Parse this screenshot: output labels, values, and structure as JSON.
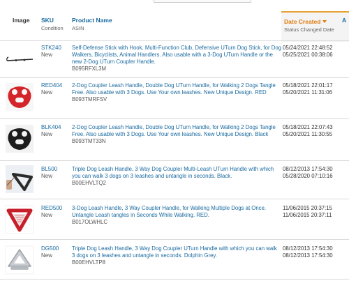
{
  "header": {
    "image": "Image",
    "sku": "SKU",
    "condition": "Condition",
    "product_name": "Product Name",
    "asin": "ASIN",
    "date_created": "Date Created",
    "status_changed": "Status Changed Date",
    "extra": "A"
  },
  "colors": {
    "link": "#1a6aa0",
    "sort_accent": "#e07b10"
  },
  "rows": [
    {
      "sku": "STK240",
      "condition": "New",
      "desc": "Self-Defense Stick with Hook, Multi-Function Club, Defensive UTurn Dog Stick, for Dog Walkers, Bicyclists, Animal Handlers. Also usable with a 3-Dog UTurn Handle or the new 2-Dog UTurn Coupler Handle.",
      "asin": "B095RFXL3M",
      "created": "05/24/2021 22:48:52",
      "changed": "05/25/2021 00:38:06",
      "thumb_icon": "stick-product-icon"
    },
    {
      "sku": "RED404",
      "condition": "New",
      "desc": "2-Dog Coupler Leash Handle, Double Dog UTurn Handle, for Walking 2 Dogs Tangle Free. Also usable with 3 Dogs. Use Your own leashes. New Unique Design. RED",
      "asin": "B093TMRFSV",
      "created": "05/18/2021 22:01:17",
      "changed": "05/20/2021 11:31:06",
      "thumb_icon": "red-coupler-handle-icon"
    },
    {
      "sku": "BLK404",
      "condition": "New",
      "desc": "2-Dog Coupler Leash Handle, Double Dog UTurn Handle, for Walking 2 Dogs Tangle Free. Also usable with 3 Dogs. Use Your own leashes. New Unique Design. Black",
      "asin": "B093TMT33N",
      "created": "05/18/2021 22:07:43",
      "changed": "05/20/2021 11:30:55",
      "thumb_icon": "black-coupler-handle-icon"
    },
    {
      "sku": "BL500",
      "condition": "New",
      "desc": "Triple Dog Leash Handle, 3 Way Dog Coupler Multi-Leash UTurn Handle with which you can walk 3 dogs on 3 leashes and untangle in seconds. Black.",
      "asin": "B00EHVLTQ2",
      "created": "08/12/2013 17:54:30",
      "changed": "05/28/2020 07:10:16",
      "thumb_icon": "triangle-handle-icon"
    },
    {
      "sku": "RED500",
      "condition": "New",
      "desc": "3-Dog Leash Handle, 3 Way Coupler Handle, for Walking Multiple Dogs at Once. Untangle Leash tangles in Seconds While Walking. RED.",
      "asin": "B017OLWHLC",
      "created": "11/06/2015 20:37:15",
      "changed": "11/06/2015 20:37:11",
      "thumb_icon": "red-triangle-handle-icon"
    },
    {
      "sku": "DG500",
      "condition": "New",
      "desc": "Triple Dog Leash Handle, 3 Way Dog Coupler UTurn Handle with which you can walk 3 dogs on 3 leashes and untangle in seconds. Dolphin Grey.",
      "asin": "B00EHVLTP8",
      "created": "08/12/2013 17:54:30",
      "changed": "08/12/2013 17:54:30",
      "thumb_icon": "grey-triangle-handle-icon"
    }
  ]
}
